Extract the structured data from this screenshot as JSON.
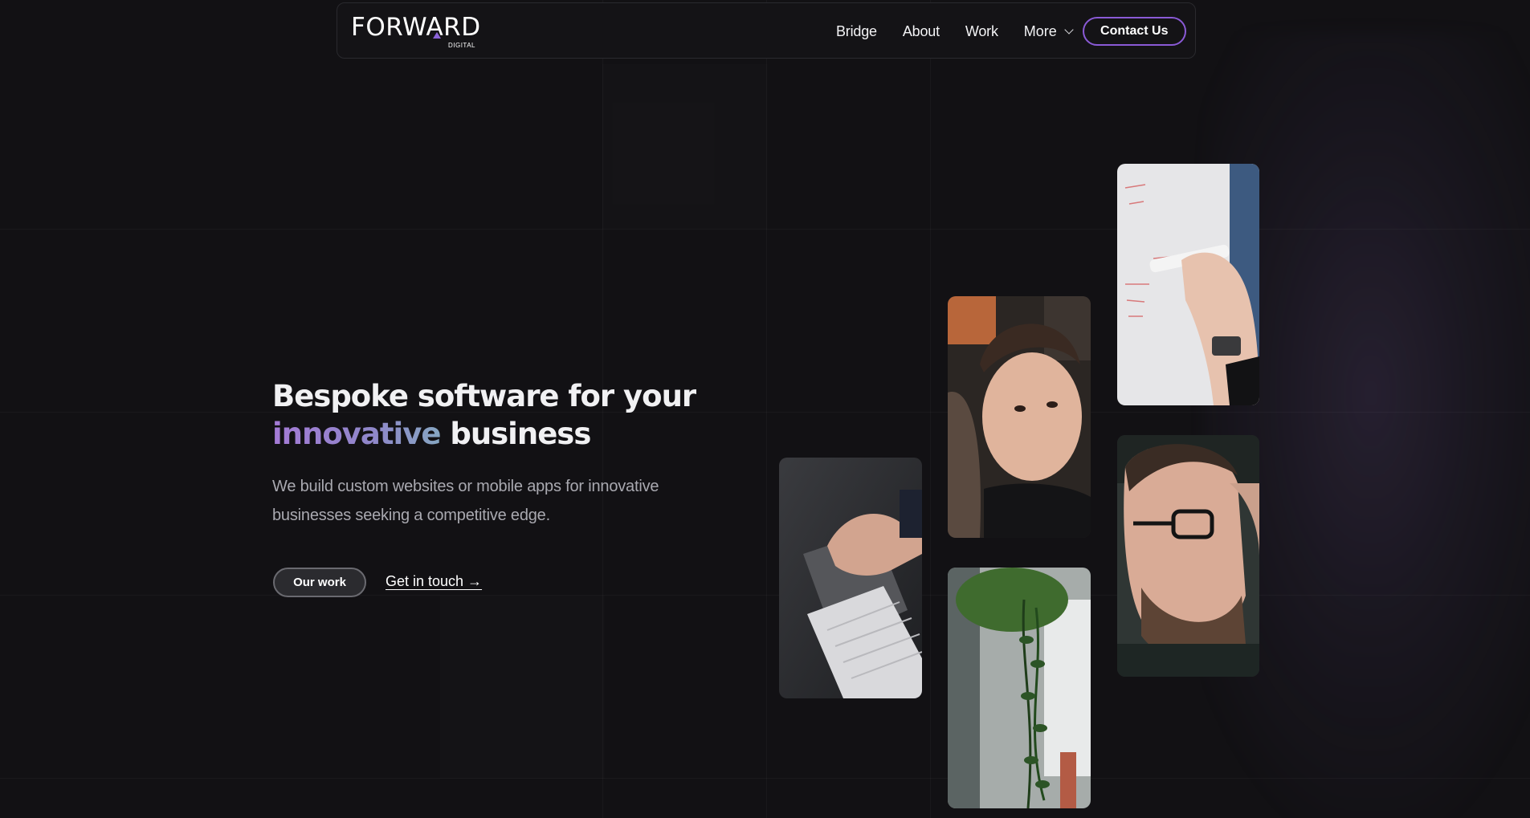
{
  "brand": {
    "logo_text": "FORWARD",
    "logo_sub": "DIGITAL",
    "accent_color": "#8a5ad6"
  },
  "nav": {
    "links": [
      "Bridge",
      "About",
      "Work"
    ],
    "more_label": "More",
    "contact_label": "Contact Us"
  },
  "hero": {
    "title_line1": "Bespoke software for your",
    "title_accent": "innovative",
    "title_rest": " business",
    "subtitle": "We build custom websites or mobile apps for innovative businesses seeking a competitive edge.",
    "primary_cta": "Our work",
    "secondary_cta": "Get in touch →"
  },
  "images": [
    {
      "name": "hands-on-laptop-photo",
      "icon": "photo-laptop"
    },
    {
      "name": "man-portrait-photo",
      "icon": "photo-portrait"
    },
    {
      "name": "hanging-plant-photo",
      "icon": "photo-plant"
    },
    {
      "name": "whiteboard-writing-photo",
      "icon": "photo-whiteboard"
    },
    {
      "name": "man-with-glasses-photo",
      "icon": "photo-glasses"
    }
  ]
}
